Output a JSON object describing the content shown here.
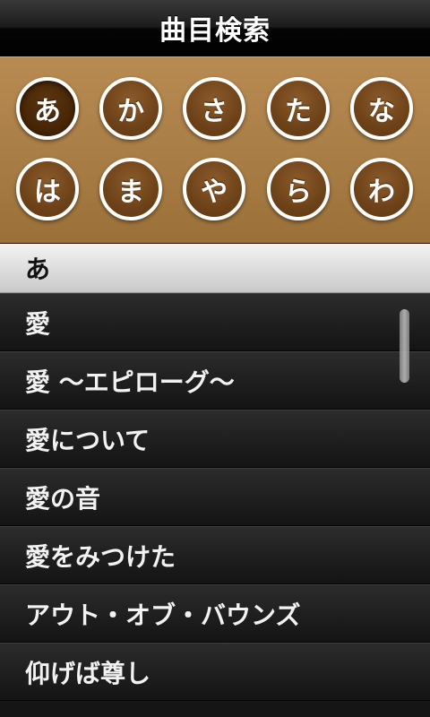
{
  "header": {
    "title": "曲目検索"
  },
  "kana": {
    "row1": [
      "あ",
      "か",
      "さ",
      "た",
      "な"
    ],
    "row2": [
      "は",
      "ま",
      "や",
      "ら",
      "わ"
    ],
    "selected": "あ"
  },
  "section": {
    "label": "あ"
  },
  "songs": [
    "愛",
    "愛 〜エピローグ〜",
    "愛について",
    "愛の音",
    "愛をみつけた",
    "アウト・オブ・バウンズ",
    "仰げば尊し"
  ]
}
